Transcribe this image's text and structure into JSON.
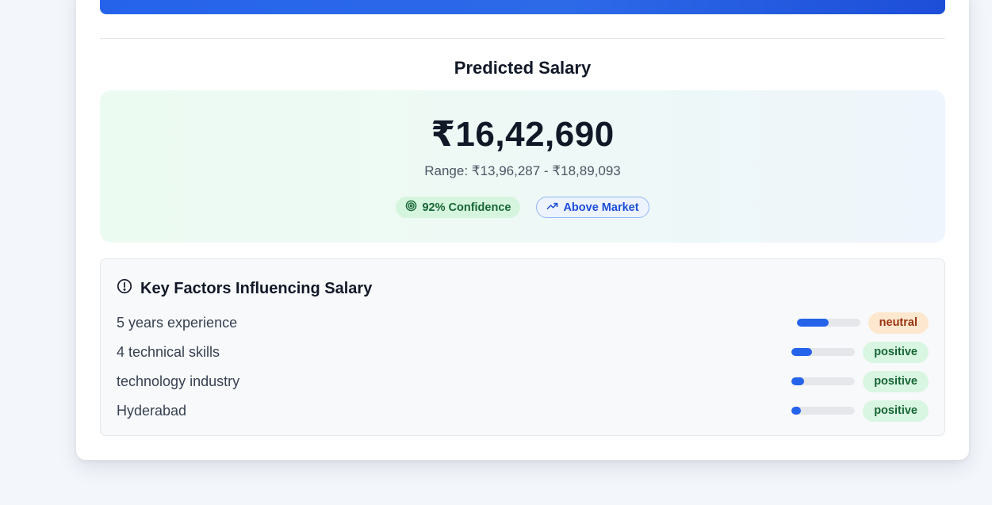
{
  "prediction": {
    "title": "Predicted Salary",
    "amount": "₹16,42,690",
    "range": "Range: ₹13,96,287 - ₹18,89,093",
    "confidence_badge": "92% Confidence",
    "market_badge": "Above Market"
  },
  "factors": {
    "title": "Key Factors Influencing Salary",
    "items": [
      {
        "label": "5 years experience",
        "impact": 0.5,
        "tag": "neutral"
      },
      {
        "label": "4 technical skills",
        "impact": 0.32,
        "tag": "positive"
      },
      {
        "label": "technology industry",
        "impact": 0.2,
        "tag": "positive"
      },
      {
        "label": "Hyderabad",
        "impact": 0.15,
        "tag": "positive"
      }
    ]
  },
  "colors": {
    "accent": "#2563eb",
    "positive_text": "#166534",
    "neutral_text": "#9a3412"
  },
  "icons": {
    "confidence": "target-icon",
    "market": "trending-up-icon",
    "factors": "alert-circle-icon"
  }
}
